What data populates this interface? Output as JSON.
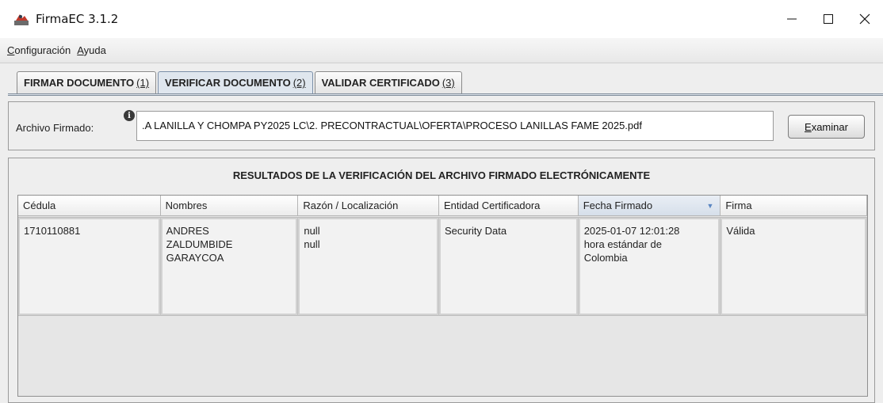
{
  "window": {
    "title": "FirmaEC 3.1.2",
    "controls": [
      "minimize-icon",
      "maximize-icon",
      "close-icon"
    ]
  },
  "menubar": {
    "items": [
      {
        "mnemonic": "C",
        "rest": "onfiguración"
      },
      {
        "mnemonic": "A",
        "rest": "yuda"
      }
    ]
  },
  "tabs": [
    {
      "label": "FIRMAR DOCUMENTO",
      "shortcut": "(1)"
    },
    {
      "label": "VERIFICAR DOCUMENTO",
      "shortcut": "(2)"
    },
    {
      "label": "VALIDAR CERTIFICADO",
      "shortcut": "(3)"
    }
  ],
  "active_tab": 1,
  "file": {
    "label": "Archivo Firmado:",
    "value": ".A LANILLA Y CHOMPA PY2025 LC\\2. PRECONTRACTUAL\\OFERTA\\PROCESO LANILLAS FAME 2025.pdf",
    "browse_mnemonic": "E",
    "browse_rest": "xaminar"
  },
  "results": {
    "title": "RESULTADOS DE LA VERIFICACIÓN DEL ARCHIVO FIRMADO ELECTRÓNICAMENTE",
    "columns": [
      "Cédula",
      "Nombres",
      "Razón / Localización",
      "Entidad Certificadora",
      "Fecha Firmado",
      "Firma"
    ],
    "sorted_column": 4,
    "rows": [
      {
        "cedula": "1710110881",
        "nombres": [
          "ANDRES",
          "ZALDUMBIDE",
          "GARAYCOA"
        ],
        "razon": [
          "null",
          "null"
        ],
        "entidad": "Security Data",
        "fecha": [
          "2025-01-07 12:01:28",
          "hora estándar de",
          "Colombia"
        ],
        "firma": "Válida"
      }
    ]
  },
  "colors": {
    "sort_arrow": "#5a86c2",
    "active_tab": "#dfe6ee"
  }
}
